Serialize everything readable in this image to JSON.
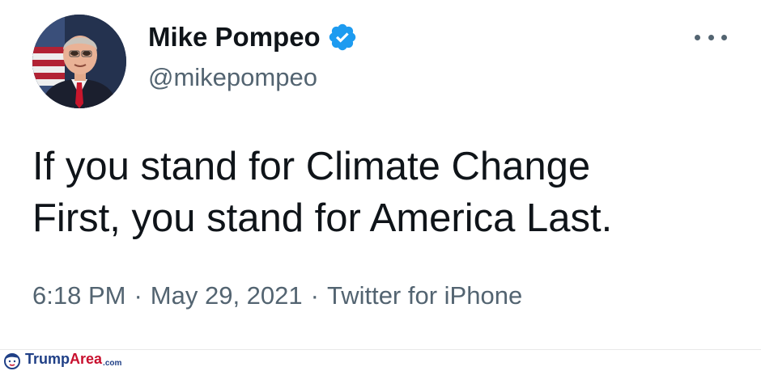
{
  "tweet": {
    "author": {
      "display_name": "Mike Pompeo",
      "handle": "@mikepompeo",
      "verified": true
    },
    "text_line1": "If you stand for Climate Change",
    "text_line2": "First, you stand for America Last.",
    "time": "6:18 PM",
    "separator": "·",
    "date": "May 29, 2021",
    "source": "Twitter for iPhone"
  },
  "icons": {
    "verified": "verified-badge-icon",
    "more": "more-options-icon",
    "watermark": "trump-area-logo-icon"
  },
  "watermark": {
    "part1": "Trump",
    "part2": "Area",
    "domain": ".com"
  },
  "colors": {
    "verified_blue": "#1d9bf0",
    "text_primary": "#0f1419",
    "text_secondary": "#536471",
    "watermark_blue": "#1f3f86",
    "watermark_red": "#c8102e"
  }
}
